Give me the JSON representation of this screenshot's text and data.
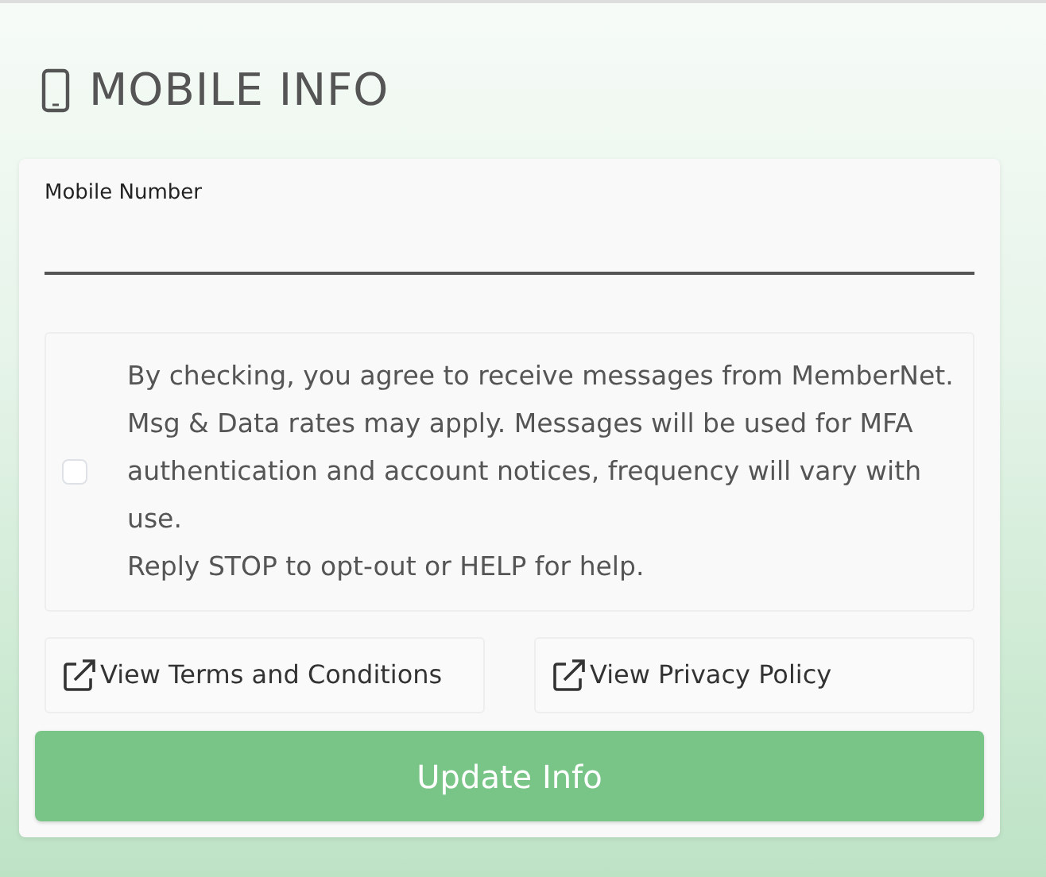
{
  "header": {
    "title": "MOBILE INFO"
  },
  "mobile_field": {
    "label": "Mobile Number"
  },
  "consent": {
    "checked": false,
    "text": "By checking, you agree to receive messages from MemberNet. Msg & Data rates may apply. Messages will be used for MFA authentication and account notices, frequency will vary with use.\nReply STOP to opt-out or HELP for help."
  },
  "links": [
    {
      "label": "View Terms and Conditions"
    },
    {
      "label": "View Privacy Policy"
    }
  ],
  "submit_button": {
    "label": "Update Info"
  }
}
